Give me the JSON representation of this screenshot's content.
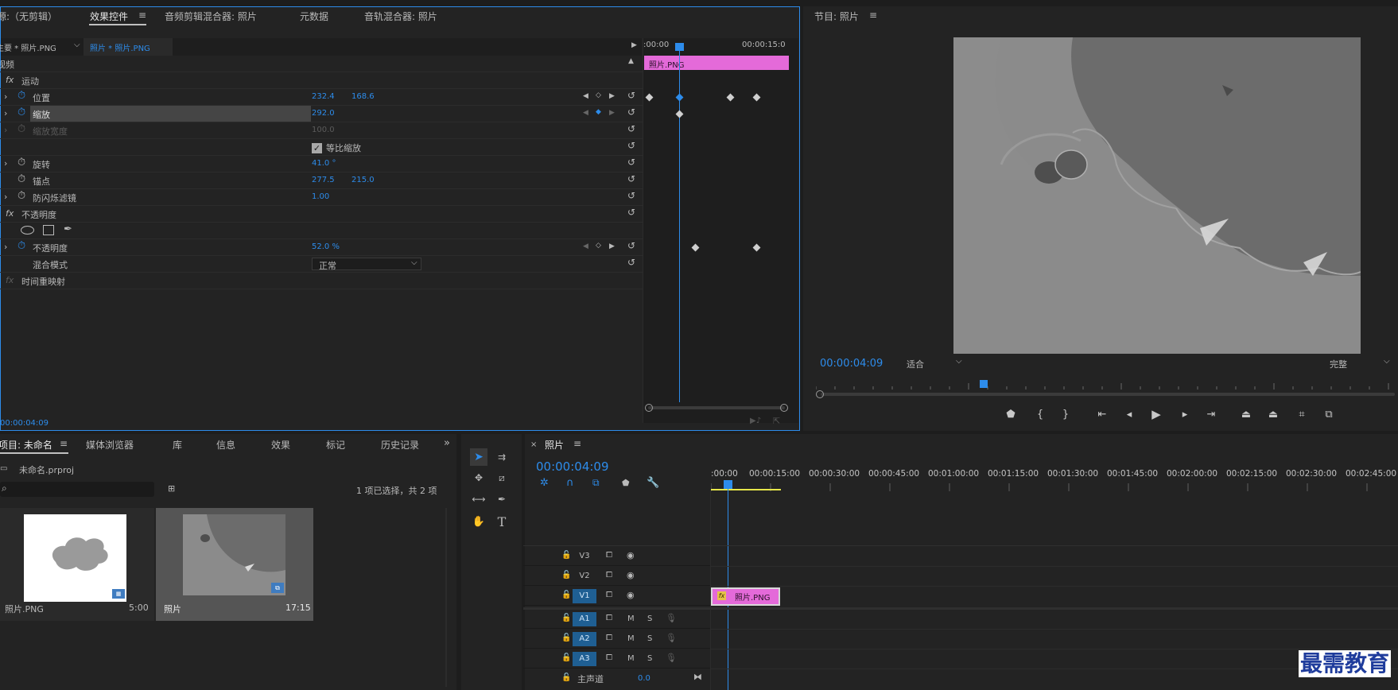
{
  "source_panel": {
    "tabs": [
      "源:（无剪辑）",
      "效果控件",
      "音频剪辑混合器: 照片",
      "元数据",
      "音轨混合器: 照片"
    ],
    "active_tab": "效果控件",
    "clip_master": "主要 * 照片.PNG",
    "clip_sequence": "照片 * 照片.PNG",
    "section_video": "视频",
    "motion": "运动",
    "position_label": "位置",
    "position_x": "232.4",
    "position_y": "168.6",
    "scale_label": "缩放",
    "scale_value": "292.0",
    "scale_width_label": "缩放宽度",
    "scale_width_value": "100.0",
    "uniform_scale_label": "等比缩放",
    "rotation_label": "旋转",
    "rotation_value": "41.0 °",
    "anchor_label": "锚点",
    "anchor_x": "277.5",
    "anchor_y": "215.0",
    "flicker_label": "防闪烁滤镜",
    "flicker_value": "1.00",
    "opacity_section": "不透明度",
    "opacity_label": "不透明度",
    "opacity_value": "52.0 %",
    "blend_label": "混合模式",
    "blend_value": "正常",
    "time_remap": "时间重映射",
    "timecode": "00:00:04:09",
    "mini_ruler_start": ":00:00",
    "mini_ruler_end": "00:00:15:0",
    "mini_clip": "照片.PNG"
  },
  "program_panel": {
    "title": "节目: 照片",
    "timecode": "00:00:04:09",
    "fit": "适合",
    "quality": "完整"
  },
  "project_panel": {
    "tabs": [
      "项目: 未命名",
      "媒体浏览器",
      "库",
      "信息",
      "效果",
      "标记",
      "历史记录"
    ],
    "project_file": "未命名.prproj",
    "selection_info": "1 项已选择，共 2 项",
    "items": [
      {
        "name": "照片.PNG",
        "duration": "5:00"
      },
      {
        "name": "照片",
        "duration": "17:15"
      }
    ]
  },
  "timeline": {
    "title": "照片",
    "timecode": "00:00:04:09",
    "ruler": ":00:00|00:00:15:00|00:00:30:00|00:00:45:00|00:01:00:00|00:01:15:00|00:01:30:00|00:01:45:00|00:02:00:00|00:02:15:00|00:02:30:00|00:02:45:00",
    "tracks_video": [
      "V3",
      "V2",
      "V1"
    ],
    "tracks_audio": [
      "A1",
      "A2",
      "A3"
    ],
    "master_label": "主声道",
    "master_value": "0.0",
    "clip_label": "照片.PNG",
    "m_label": "M",
    "s_label": "S"
  },
  "watermark": "最需教育"
}
